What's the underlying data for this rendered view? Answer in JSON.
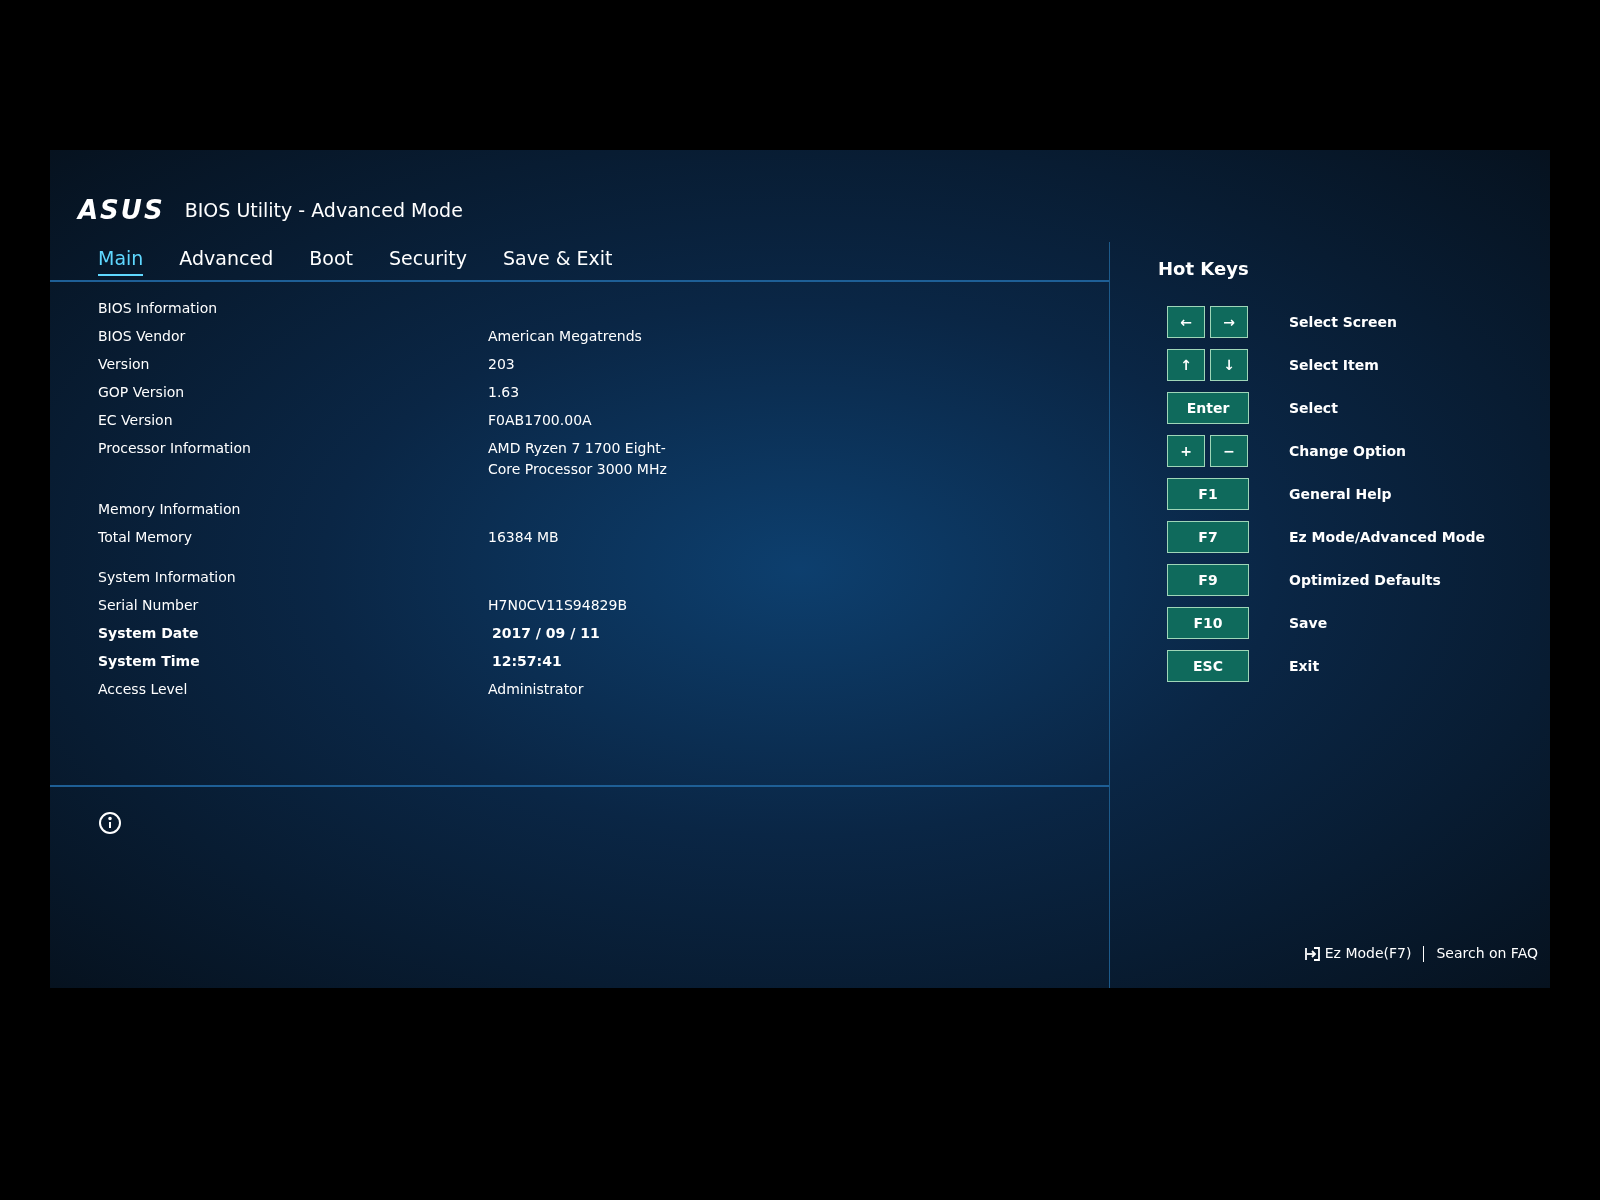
{
  "header": {
    "logo": "ASUS",
    "title": "BIOS Utility - Advanced Mode"
  },
  "tabs": [
    {
      "label": "Main",
      "selected": true
    },
    {
      "label": "Advanced",
      "selected": false
    },
    {
      "label": "Boot",
      "selected": false
    },
    {
      "label": "Security",
      "selected": false
    },
    {
      "label": "Save & Exit",
      "selected": false
    }
  ],
  "rows": [
    {
      "kind": "heading",
      "label": "BIOS Information"
    },
    {
      "kind": "field",
      "label": "BIOS Vendor",
      "value": "American Megatrends"
    },
    {
      "kind": "field",
      "label": "Version",
      "value": "203"
    },
    {
      "kind": "field",
      "label": "GOP Version",
      "value": "1.63"
    },
    {
      "kind": "field",
      "label": "EC Version",
      "value": "F0AB1700.00A"
    },
    {
      "kind": "field",
      "label": "Processor Information",
      "value": "AMD Ryzen 7 1700 Eight-Core Processor  3000 MHz"
    },
    {
      "kind": "heading",
      "label": "Memory Information"
    },
    {
      "kind": "field",
      "label": "Total Memory",
      "value": "16384 MB"
    },
    {
      "kind": "heading",
      "label": "System Information"
    },
    {
      "kind": "field",
      "label": "Serial Number",
      "value": "H7N0CV11S94829B"
    },
    {
      "kind": "editable",
      "label": "System Date",
      "value": "2017 / 09 / 11"
    },
    {
      "kind": "editable",
      "label": "System Time",
      "value": "12:57:41"
    },
    {
      "kind": "field",
      "label": "Access Level",
      "value": "Administrator"
    }
  ],
  "hot_keys": {
    "title": "Hot Keys",
    "items": [
      {
        "keys": [
          "←",
          "→"
        ],
        "action": "Select Screen"
      },
      {
        "keys": [
          "↑",
          "↓"
        ],
        "action": "Select Item"
      },
      {
        "keys": [
          "Enter"
        ],
        "action": "Select"
      },
      {
        "keys": [
          "+",
          "−"
        ],
        "action": "Change Option"
      },
      {
        "keys": [
          "F1"
        ],
        "action": "General Help"
      },
      {
        "keys": [
          "F7"
        ],
        "action": "Ez Mode/Advanced Mode"
      },
      {
        "keys": [
          "F9"
        ],
        "action": "Optimized Defaults"
      },
      {
        "keys": [
          "F10"
        ],
        "action": "Save"
      },
      {
        "keys": [
          "ESC"
        ],
        "action": "Exit"
      }
    ]
  },
  "footer": {
    "links": [
      "Ez Mode(F7)",
      "Search on FAQ"
    ]
  }
}
